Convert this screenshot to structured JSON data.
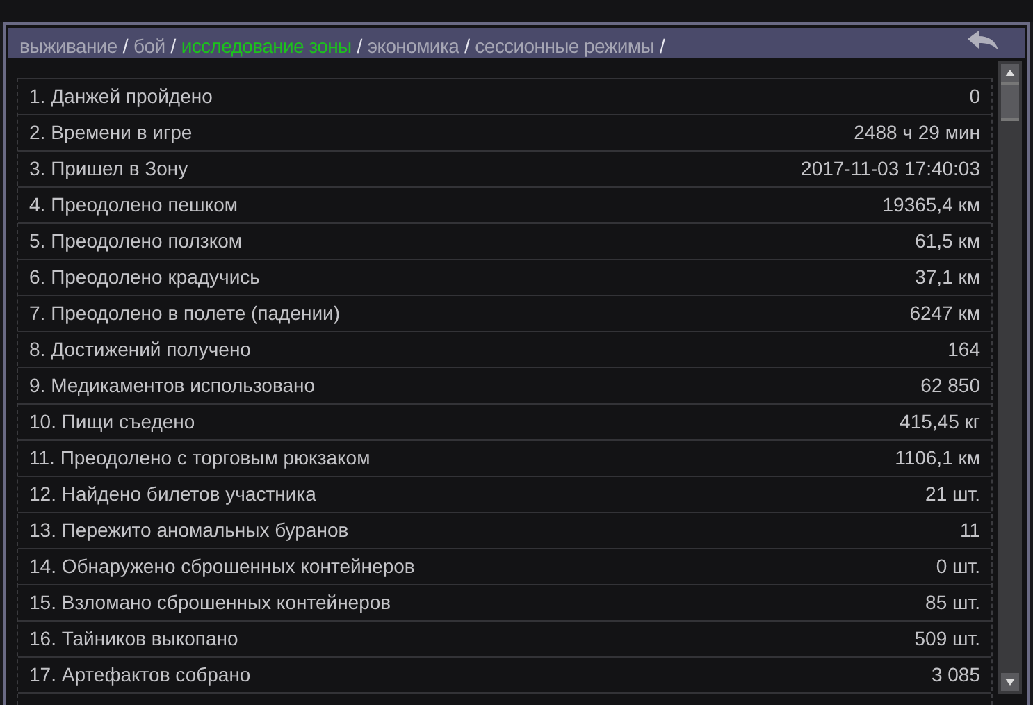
{
  "breadcrumbs": [
    {
      "label": "выживание",
      "selected": false
    },
    {
      "label": "бой",
      "selected": false
    },
    {
      "label": "исследование зоны",
      "selected": true
    },
    {
      "label": "экономика",
      "selected": false
    },
    {
      "label": "сессионные режимы",
      "selected": false
    }
  ],
  "separator": "/",
  "stats": [
    {
      "label": "1. Данжей пройдено",
      "value": "0"
    },
    {
      "label": "2. Времени в игре",
      "value": "2488 ч 29 мин"
    },
    {
      "label": "3. Пришел в Зону",
      "value": "2017-11-03 17:40:03"
    },
    {
      "label": "4. Преодолено пешком",
      "value": "19365,4 км"
    },
    {
      "label": "5. Преодолено ползком",
      "value": "61,5 км"
    },
    {
      "label": "6. Преодолено крадучись",
      "value": "37,1 км"
    },
    {
      "label": "7. Преодолено в полете (падении)",
      "value": "6247 км"
    },
    {
      "label": "8. Достижений получено",
      "value": "164"
    },
    {
      "label": "9. Медикаментов использовано",
      "value": "62 850"
    },
    {
      "label": "10. Пищи съедено",
      "value": "415,45 кг"
    },
    {
      "label": "11. Преодолено с торговым рюкзаком",
      "value": "1106,1 км"
    },
    {
      "label": "12. Найдено билетов участника",
      "value": "21 шт."
    },
    {
      "label": "13. Пережито аномальных буранов",
      "value": "11"
    },
    {
      "label": "14. Обнаружено сброшенных контейнеров",
      "value": "0 шт."
    },
    {
      "label": "15. Взломано сброшенных контейнеров",
      "value": "85 шт."
    },
    {
      "label": "16. Тайников выкопано",
      "value": "509 шт."
    },
    {
      "label": "17. Артефактов собрано",
      "value": "3 085"
    }
  ]
}
